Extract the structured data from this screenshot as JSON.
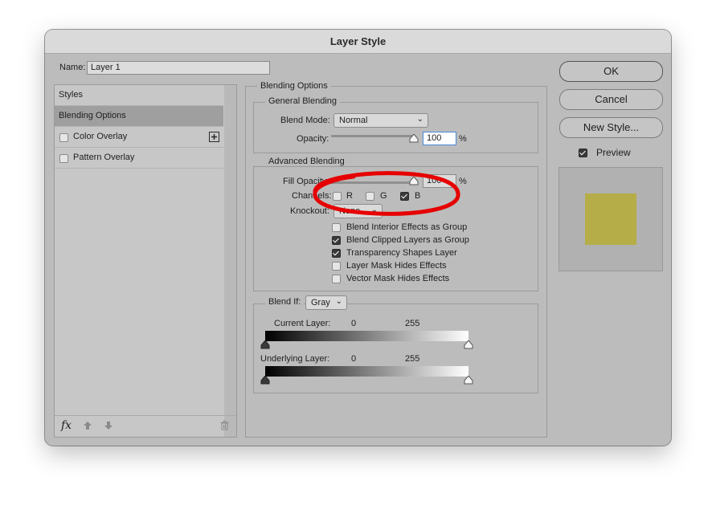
{
  "dialog": {
    "title": "Layer Style",
    "name_label": "Name:",
    "name_value": "Layer 1"
  },
  "styles_list": {
    "items": [
      {
        "label": "Styles",
        "selected": false,
        "checkbox": false
      },
      {
        "label": "Blending Options",
        "selected": true,
        "checkbox": false
      },
      {
        "label": "Color Overlay",
        "selected": false,
        "checkbox": true,
        "checked": false,
        "add_icon": "plus-square-icon"
      },
      {
        "label": "Pattern Overlay",
        "selected": false,
        "checkbox": true,
        "checked": false
      }
    ],
    "footer_icons": [
      "fx-icon",
      "arrow-up-icon",
      "arrow-down-icon",
      "trash-icon"
    ],
    "fx_label": "fx"
  },
  "blending": {
    "section_title": "Blending Options",
    "general": {
      "title": "General Blending",
      "blend_mode_label": "Blend Mode:",
      "blend_mode_value": "Normal",
      "opacity_label": "Opacity:",
      "opacity_value": "100",
      "opacity_unit": "%"
    },
    "advanced": {
      "title": "Advanced Blending",
      "fill_opacity_label": "Fill Opacity:",
      "fill_opacity_value": "100",
      "fill_opacity_unit": "%",
      "channels_label": "Channels:",
      "channels": [
        {
          "label": "R",
          "checked": false
        },
        {
          "label": "G",
          "checked": false
        },
        {
          "label": "B",
          "checked": true
        }
      ],
      "knockout_label": "Knockout:",
      "knockout_value": "None",
      "options": [
        {
          "label": "Blend Interior Effects as Group",
          "checked": false
        },
        {
          "label": "Blend Clipped Layers as Group",
          "checked": true
        },
        {
          "label": "Transparency Shapes Layer",
          "checked": true
        },
        {
          "label": "Layer Mask Hides Effects",
          "checked": false
        },
        {
          "label": "Vector Mask Hides Effects",
          "checked": false
        }
      ]
    },
    "blend_if": {
      "label": "Blend If:",
      "value": "Gray",
      "current_layer_label": "Current Layer:",
      "current_min": "0",
      "current_max": "255",
      "underlying_layer_label": "Underlying Layer:",
      "underlying_min": "0",
      "underlying_max": "255"
    }
  },
  "buttons": {
    "ok": "OK",
    "cancel": "Cancel",
    "new_style": "New Style...",
    "preview_label": "Preview",
    "preview_checked": true
  },
  "preview": {
    "swatch_color": "#b5ad48",
    "background_color": "#b1b1b1"
  },
  "annotation": {
    "color": "#e60000",
    "shape": "hand-drawn-ellipse"
  }
}
